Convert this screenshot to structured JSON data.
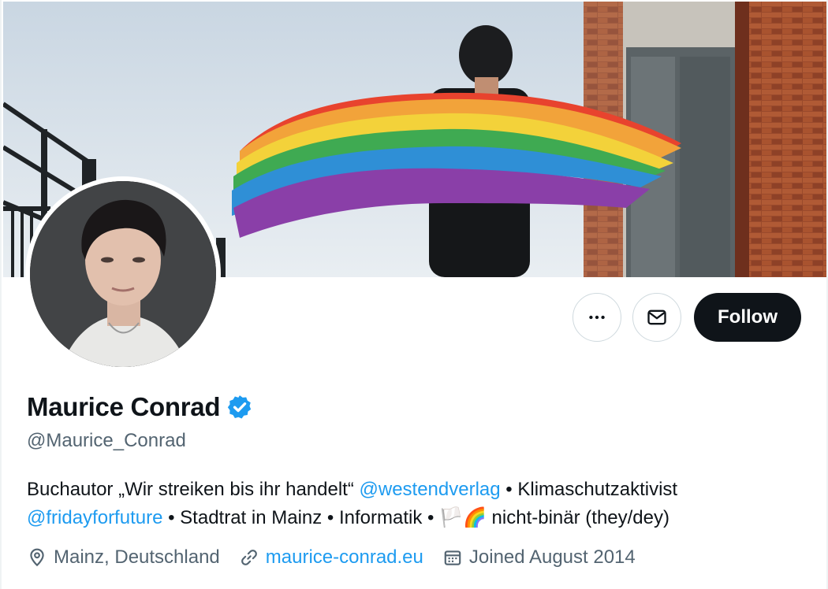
{
  "profile": {
    "name": "Maurice Conrad",
    "handle": "@Maurice_Conrad",
    "verified": true,
    "bio": {
      "line1_a": "Buchautor „Wir streiken bis ihr handelt“ ",
      "line1_mention": "@westendverlag",
      "line1_b": " • Klimaschutzaktivist",
      "line2_mention": "@fridayforfuture",
      "line2_a": " • Stadtrat in Mainz • Informatik • ",
      "line2_emoji_flag": "🏳️",
      "line2_emoji_rainbow": "🌈",
      "line2_b": " nicht-binär (they/dey)"
    },
    "location": "Mainz, Deutschland",
    "website": "maurice-conrad.eu",
    "joined": "Joined August 2014"
  },
  "actions": {
    "more_icon": "more-horizontal-icon",
    "message_icon": "mail-icon",
    "follow_label": "Follow"
  },
  "colors": {
    "accent": "#1d9bf0",
    "text": "#0f1419",
    "secondary": "#536471",
    "follow_bg": "#0f1419",
    "border": "#cfd9de"
  }
}
